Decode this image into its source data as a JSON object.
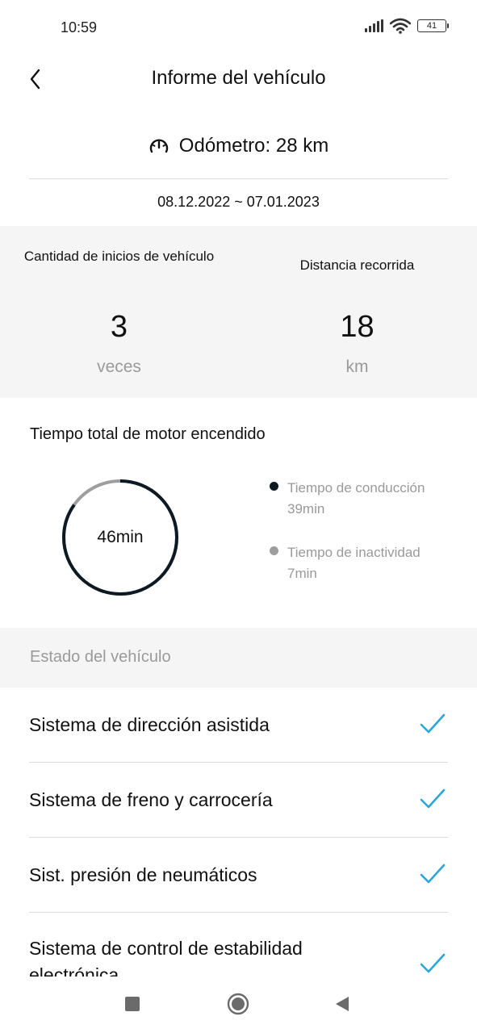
{
  "status_bar": {
    "time": "10:59",
    "battery": "41"
  },
  "header": {
    "title": "Informe del vehículo"
  },
  "odometer": {
    "text": "Odómetro: 28 km"
  },
  "date_range": "08.12.2022 ~ 07.01.2023",
  "stats": {
    "starts": {
      "label": "Cantidad de inicios de vehículo",
      "value": "3",
      "unit": "veces"
    },
    "distance": {
      "label": "Distancia recorrida",
      "value": "18",
      "unit": "km"
    }
  },
  "engine": {
    "title": "Tiempo total de motor encendido",
    "total": "46min",
    "driving": {
      "label": "Tiempo de conducción",
      "value": "39min",
      "minutes": 39,
      "color": "#0d1a24"
    },
    "idle": {
      "label": "Tiempo de inactividad",
      "value": "7min",
      "minutes": 7,
      "color": "#9e9e9e"
    }
  },
  "status_section": {
    "title": "Estado del vehículo",
    "items": [
      {
        "label": "Sistema de dirección asistida"
      },
      {
        "label": "Sistema de freno y carrocería"
      },
      {
        "label": "Sist. presión de neumáticos"
      },
      {
        "label": "Sistema de control de estabilidad electrónica"
      }
    ]
  },
  "colors": {
    "accent": "#2aa7d8",
    "dark": "#0d1a24",
    "muted": "#9a9a9a",
    "panel": "#f5f5f5"
  },
  "icons": [
    "back-arrow-icon",
    "speedometer-icon",
    "check-icon",
    "signal-icon",
    "wifi-icon",
    "battery-icon",
    "nav-recents-icon",
    "nav-home-icon",
    "nav-back-icon"
  ]
}
